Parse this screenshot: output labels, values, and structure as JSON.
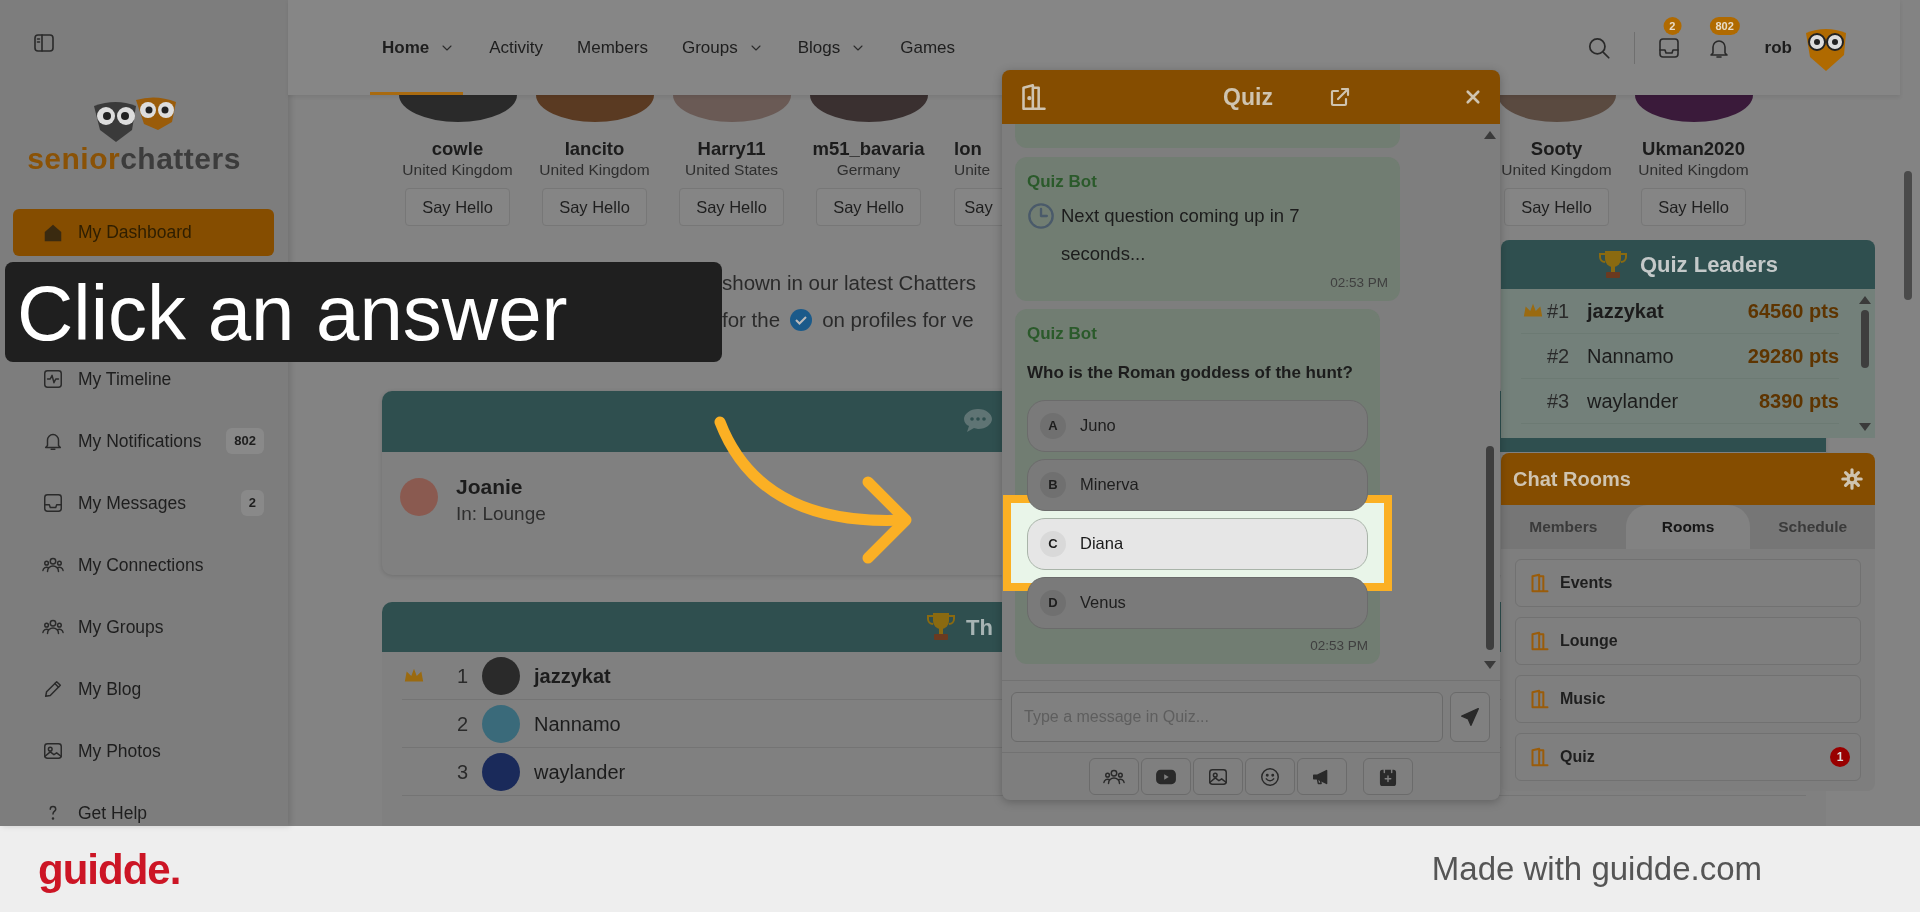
{
  "sidebar": {
    "logo": {
      "part_1": "senior",
      "part_2": "chatters"
    },
    "items": [
      {
        "label": "My Dashboard",
        "selected": true
      },
      {
        "label": "My Timeline",
        "selected": false
      },
      {
        "label": "My Notifications",
        "selected": false,
        "badge": "802"
      },
      {
        "label": "My Messages",
        "selected": false,
        "badge": "2"
      },
      {
        "label": "My Connections",
        "selected": false
      },
      {
        "label": "My Groups",
        "selected": false
      },
      {
        "label": "My Blog",
        "selected": false
      },
      {
        "label": "My Photos",
        "selected": false
      },
      {
        "label": "Get Help",
        "selected": false
      }
    ]
  },
  "nav": {
    "items": [
      {
        "label": "Home",
        "selected": true,
        "dropdown": true
      },
      {
        "label": "Activity",
        "selected": false,
        "dropdown": false
      },
      {
        "label": "Members",
        "selected": false,
        "dropdown": false
      },
      {
        "label": "Groups",
        "selected": false,
        "dropdown": true
      },
      {
        "label": "Blogs",
        "selected": false,
        "dropdown": true
      },
      {
        "label": "Games",
        "selected": false,
        "dropdown": false
      }
    ]
  },
  "header": {
    "inbox_badge": "2",
    "notifications_badge": "802",
    "user": "rob"
  },
  "members": [
    {
      "name": "cowle",
      "country": "United Kingdom",
      "button": "Say Hello",
      "kind": "full"
    },
    {
      "name": "Iancito",
      "country": "United Kingdom",
      "button": "Say Hello",
      "kind": "full"
    },
    {
      "name": "Harry11",
      "country": "United States",
      "button": "Say Hello",
      "kind": "full"
    },
    {
      "name": "m51_bavaria",
      "country": "Germany",
      "button": "Say Hello",
      "kind": "full"
    },
    {
      "name": "lon",
      "country": "Unite",
      "button": "Say",
      "kind": "partial"
    },
    {
      "name": "Sooty",
      "country": "United Kingdom",
      "button": "Say Hello",
      "kind": "full"
    },
    {
      "name": "Ukman2020",
      "country": "United Kingdom",
      "button": "Say Hello",
      "kind": "full"
    }
  ],
  "promo": {
    "line_1": "shown in our latest Chatters",
    "line_2_before": "for the",
    "line_2_after": "on profiles for ve"
  },
  "online_card": {
    "name": "Joanie",
    "room": "In: Lounge"
  },
  "leaderboard": {
    "title": "Th",
    "rows": [
      {
        "rank": "1",
        "name": "jazzykat",
        "crown": true
      },
      {
        "rank": "2",
        "name": "Nannamo",
        "crown": false
      },
      {
        "rank": "3",
        "name": "waylander",
        "crown": false
      }
    ]
  },
  "quiz_window": {
    "title": "Quiz",
    "messages": [
      {
        "kind": "countdown",
        "sender": "Quiz Bot",
        "text": "Next question coming up in 7 seconds...",
        "time": "02:53 PM"
      },
      {
        "kind": "question",
        "sender": "Quiz Bot",
        "question": "Who is the Roman goddess of the hunt?",
        "time": "02:53 PM",
        "options": [
          {
            "letter": "A",
            "text": "Juno",
            "highlighted": false
          },
          {
            "letter": "B",
            "text": "Minerva",
            "highlighted": false
          },
          {
            "letter": "C",
            "text": "Diana",
            "highlighted": true
          },
          {
            "letter": "D",
            "text": "Venus",
            "highlighted": false
          }
        ]
      }
    ],
    "input": {
      "placeholder": "Type a message in Quiz..."
    }
  },
  "quiz_leaders": {
    "title": "Quiz Leaders",
    "rows": [
      {
        "rank": "#1",
        "name": "jazzykat",
        "points": "64560 pts",
        "crown": true
      },
      {
        "rank": "#2",
        "name": "Nannamo",
        "points": "29280 pts",
        "crown": false
      },
      {
        "rank": "#3",
        "name": "waylander",
        "points": "8390 pts",
        "crown": false
      }
    ]
  },
  "chat_rooms": {
    "title": "Chat Rooms",
    "tabs": [
      {
        "label": "Members",
        "selected": false
      },
      {
        "label": "Rooms",
        "selected": true
      },
      {
        "label": "Schedule",
        "selected": false
      }
    ],
    "rooms": [
      {
        "name": "Events"
      },
      {
        "name": "Lounge"
      },
      {
        "name": "Music"
      },
      {
        "name": "Quiz",
        "badge": "1"
      }
    ]
  },
  "tutorial": {
    "callout": "Click an answer"
  },
  "footer": {
    "logo": "guidde.",
    "credit": "Made with guidde.com"
  }
}
